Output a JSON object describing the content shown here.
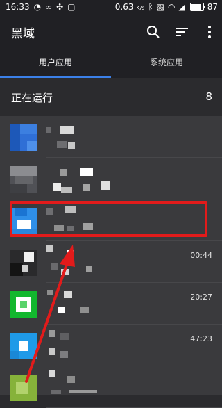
{
  "status_bar": {
    "time": "16:33",
    "network_speed": "0.63",
    "network_unit": "K/s",
    "battery": "87",
    "battery_level": 0.87
  },
  "header": {
    "title": "黑域"
  },
  "tabs": [
    {
      "label": "用户应用",
      "active": true
    },
    {
      "label": "系统应用",
      "active": false
    }
  ],
  "section": {
    "title": "正在运行",
    "count": "8"
  },
  "app_rows": [
    {
      "time": ""
    },
    {
      "time": ""
    },
    {
      "time": ""
    },
    {
      "time": "00:44"
    },
    {
      "time": "20:27"
    },
    {
      "time": "47:23"
    },
    {
      "time": ""
    }
  ],
  "colors": {
    "accent": "#3b80e8",
    "highlight": "#e21b1b",
    "bar_bg": "#202024",
    "list_bg": "#3a3a3d"
  }
}
